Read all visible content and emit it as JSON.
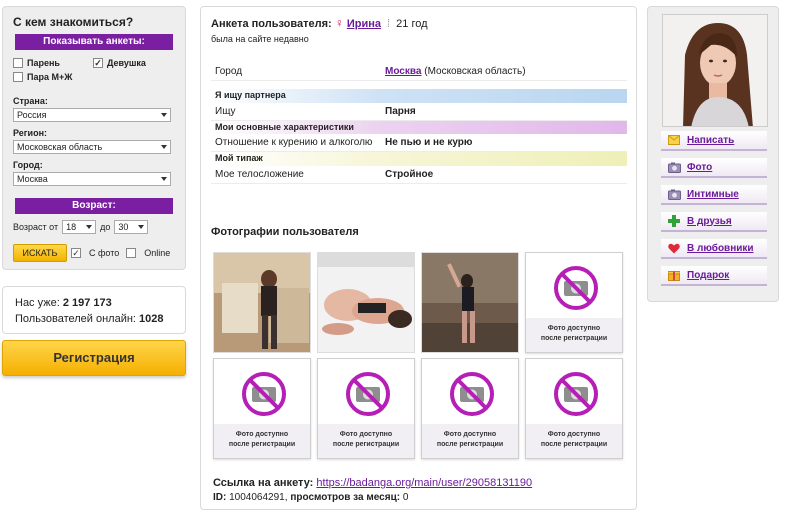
{
  "search": {
    "title": "С кем знакомиться?",
    "show_label": "Показывать анкеты:",
    "options": [
      {
        "label": "Парень",
        "checked": false
      },
      {
        "label": "Девушка",
        "checked": true
      },
      {
        "label": "Пара М+Ж",
        "checked": false
      }
    ],
    "country_label": "Страна:",
    "country_value": "Россия",
    "region_label": "Регион:",
    "region_value": "Московская область",
    "city_label": "Город:",
    "city_value": "Москва",
    "age_label": "Возраст:",
    "age_from_label": "Возраст от",
    "age_from": "18",
    "age_to_label": "до",
    "age_to": "30",
    "search_button": "ИСКАТЬ",
    "with_photo_label": "С фото",
    "with_photo_checked": true,
    "online_label": "Online",
    "online_checked": false
  },
  "stats": {
    "total_label": "Нас уже:",
    "total_value": "2 197 173",
    "online_label": "Пользователей онлайн:",
    "online_value": "1028"
  },
  "register_button": "Регистрация",
  "profile": {
    "heading": "Анкета пользователя:",
    "gender_icon": "female-icon",
    "name": "Ирина",
    "age": "21 год",
    "last_seen": "была на сайте недавно",
    "city_label": "Город",
    "city_link": "Москва",
    "city_region": "(Московская область)",
    "section_seek": "Я ищу партнера",
    "seek_label": "Ищу",
    "seek_value": "Парня",
    "section_main": "Мои основные характеристики",
    "smoke_label": "Отношение к курению и алкоголю",
    "smoke_value": "Не пью и не курю",
    "section_type": "Мой типаж",
    "body_label": "Мое телосложение",
    "body_value": "Стройное",
    "photos_title": "Фотографии пользователя",
    "locked_caption_1": "Фото доступно",
    "locked_caption_2": "после регистрации",
    "link_label": "Ссылка на анкету:",
    "link_url": "https://badanga.org/main/user/29058131190",
    "id_label": "ID:",
    "id_value": "1004064291,",
    "views_label": "просмотров за месяц:",
    "views_value": "0"
  },
  "actions": [
    {
      "label": "Написать",
      "icon": "envelope-icon"
    },
    {
      "label": "Фото",
      "icon": "camera-icon"
    },
    {
      "label": "Интимные",
      "icon": "camera-icon"
    },
    {
      "label": "В друзья",
      "icon": "plus-icon"
    },
    {
      "label": "В любовники",
      "icon": "heart-icon"
    },
    {
      "label": "Подарок",
      "icon": "gift-icon"
    }
  ],
  "colors": {
    "accent_purple": "#7b1fa2",
    "link_purple": "#6a1b9a",
    "button_yellow": "#f5b000"
  }
}
